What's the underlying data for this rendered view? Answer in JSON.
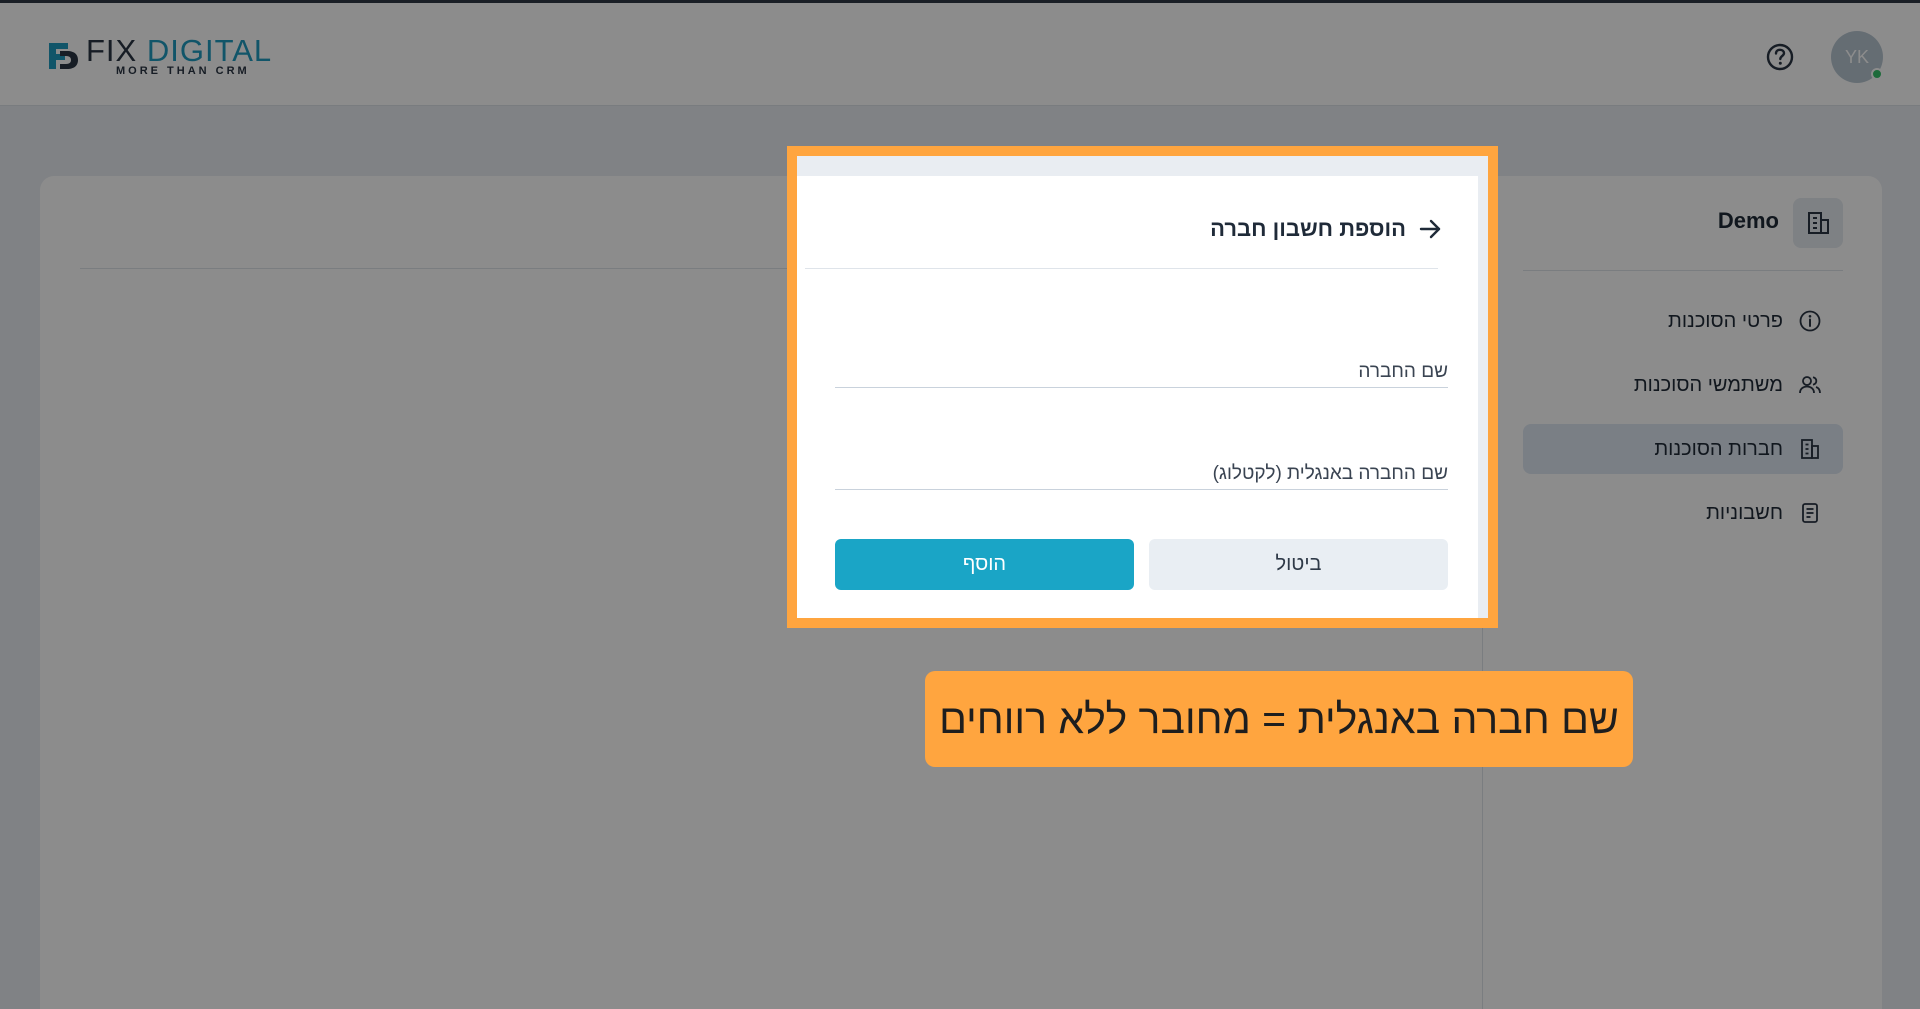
{
  "brand": {
    "logo_fix": "FIX",
    "logo_digital": "DIGITAL",
    "logo_tagline": "MORE THAN CRM"
  },
  "header": {
    "help_icon": "help-circle-icon",
    "avatar_initials": "YK",
    "avatar_status_color": "#36c26a"
  },
  "sidebar": {
    "company_name": "Demo",
    "company_icon": "building-icon",
    "items": [
      {
        "label": "פרטי הסוכנות",
        "icon": "info-icon",
        "active": false
      },
      {
        "label": "משתמשי הסוכנות",
        "icon": "users-icon",
        "active": false
      },
      {
        "label": "חברות הסוכנות",
        "icon": "building-icon",
        "active": true
      },
      {
        "label": "חשבוניות",
        "icon": "document-icon",
        "active": false
      }
    ]
  },
  "modal": {
    "title": "הוספת חשבון חברה",
    "back_icon": "arrow-right-icon",
    "company_name_placeholder": "שם החברה",
    "company_name_en_placeholder": "שם החברה באנגלית (לקטלוג)",
    "cancel_label": "ביטול",
    "add_label": "הוסף"
  },
  "callout": {
    "text": "שם חברה באנגלית = מחובר ללא רווחים"
  },
  "colors": {
    "accent": "#1aa5c6",
    "highlight": "#ffa53f",
    "active_nav": "#dfe8f3"
  }
}
